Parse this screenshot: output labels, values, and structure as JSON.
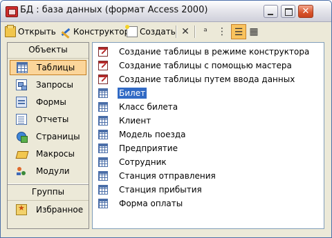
{
  "window": {
    "title": "БД : база данных (формат Access 2000)"
  },
  "toolbar": {
    "open_label": "Открыть",
    "design_label": "Конструктор",
    "new_label": "Создать",
    "delete_glyph": "✕",
    "large_icons_glyph": "ᵃ",
    "small_icons_glyph": "⋮",
    "list_glyph": "☰",
    "details_glyph": "▦"
  },
  "sidebar": {
    "objects_header": "Объекты",
    "groups_header": "Группы",
    "items": [
      {
        "label": "Таблицы",
        "icon": "table-icon",
        "selected": true
      },
      {
        "label": "Запросы",
        "icon": "query-icon"
      },
      {
        "label": "Формы",
        "icon": "form-icon"
      },
      {
        "label": "Отчеты",
        "icon": "report-icon"
      },
      {
        "label": "Страницы",
        "icon": "page-icon"
      },
      {
        "label": "Макросы",
        "icon": "macro-icon"
      },
      {
        "label": "Модули",
        "icon": "module-icon"
      }
    ],
    "favorites_label": "Избранное"
  },
  "objects": [
    {
      "label": "Создание таблицы в режиме конструктора",
      "icon": "wizard-icon"
    },
    {
      "label": "Создание таблицы с помощью мастера",
      "icon": "wizard-icon"
    },
    {
      "label": "Создание таблицы путем ввода данных",
      "icon": "wizard-icon"
    },
    {
      "label": "Билет",
      "icon": "table-icon",
      "selected": true
    },
    {
      "label": "Класс билета",
      "icon": "table-icon"
    },
    {
      "label": "Клиент",
      "icon": "table-icon"
    },
    {
      "label": "Модель поезда",
      "icon": "table-icon"
    },
    {
      "label": "Предприятие",
      "icon": "table-icon"
    },
    {
      "label": "Сотрудник",
      "icon": "table-icon"
    },
    {
      "label": "Станция отправления",
      "icon": "table-icon"
    },
    {
      "label": "Станция прибытия",
      "icon": "table-icon"
    },
    {
      "label": "Форма оплаты",
      "icon": "table-icon"
    }
  ],
  "colors": {
    "selection": "#316ac5",
    "sidebar_selected": "#fbd59a",
    "window_border": "#4a6ea8"
  }
}
